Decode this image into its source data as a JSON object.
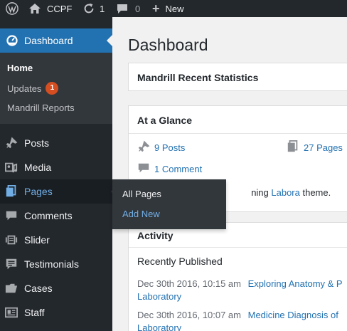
{
  "adminbar": {
    "site_name": "CCPF",
    "updates_count": "1",
    "comments_count": "0",
    "new_label": "New"
  },
  "sidebar": {
    "dashboard_label": "Dashboard",
    "submenu": [
      {
        "label": "Home"
      },
      {
        "label": "Updates",
        "badge": "1"
      },
      {
        "label": "Mandrill Reports"
      }
    ],
    "items": [
      {
        "label": "Posts",
        "icon": "pin-icon"
      },
      {
        "label": "Media",
        "icon": "media-icon"
      },
      {
        "label": "Pages",
        "icon": "pages-icon"
      },
      {
        "label": "Comments",
        "icon": "comment-icon"
      },
      {
        "label": "Slider",
        "icon": "slider-icon"
      },
      {
        "label": "Testimonials",
        "icon": "testimonial-icon"
      },
      {
        "label": "Cases",
        "icon": "folder-icon"
      },
      {
        "label": "Staff",
        "icon": "id-card-icon"
      }
    ]
  },
  "flyout": {
    "items": [
      {
        "label": "All Pages"
      },
      {
        "label": "Add New"
      }
    ]
  },
  "main": {
    "title": "Dashboard",
    "mandrill_box_title": "Mandrill Recent Statistics",
    "glance": {
      "title": "At a Glance",
      "posts": "9 Posts",
      "pages": "27 Pages",
      "comments": "1 Comment",
      "theme_prefix": "ning ",
      "theme_name": "Labora",
      "theme_suffix": " theme."
    },
    "activity": {
      "title": "Activity",
      "subtitle": "Recently Published",
      "rows": [
        {
          "date": "Dec 30th 2016, 10:15 am",
          "title_line1": "Exploring Anatomy & P",
          "title_line2": "Laboratory"
        },
        {
          "date": "Dec 30th 2016, 10:07 am",
          "title_line1": "Medicine Diagnosis of",
          "title_line2": "Laboratory"
        }
      ]
    }
  },
  "colors": {
    "adminbar_bg": "#23282d",
    "accent_blue": "#2271b1",
    "badge_orange": "#d54e21",
    "link_light_blue": "#72aee6"
  }
}
